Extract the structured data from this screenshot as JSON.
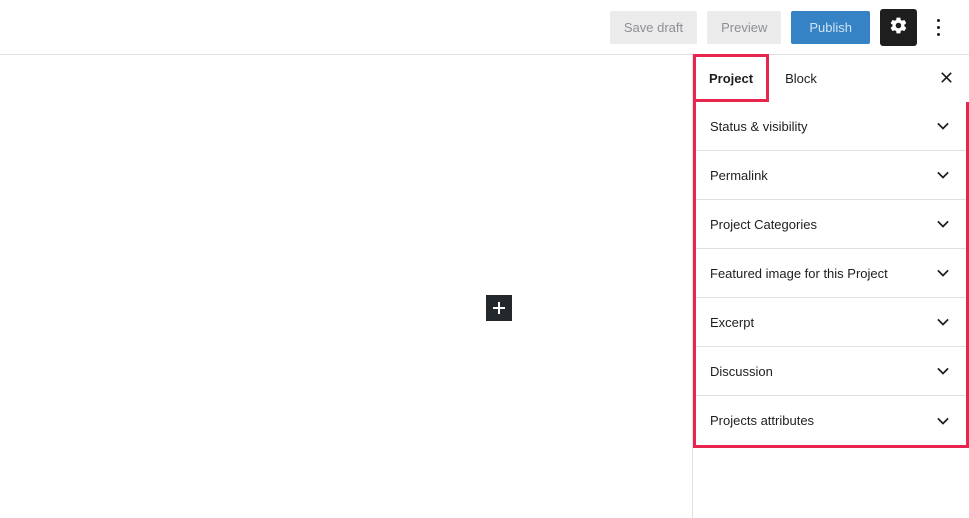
{
  "topbar": {
    "save_draft_label": "Save draft",
    "preview_label": "Preview",
    "publish_label": "Publish",
    "settings_icon": "gear-icon",
    "more_options_icon": "kebab-menu-icon",
    "colors": {
      "publish_bg": "#3582c4",
      "secondary_bg": "#ebebeb",
      "icon_button_bg": "#1e1e1e"
    }
  },
  "canvas": {
    "add_block_icon": "plus-icon"
  },
  "sidebar": {
    "tabs": [
      {
        "label": "Project",
        "active": true
      },
      {
        "label": "Block",
        "active": false
      }
    ],
    "close_icon": "close-icon",
    "panels": [
      {
        "label": "Status & visibility",
        "icon": "chevron-down-icon"
      },
      {
        "label": "Permalink",
        "icon": "chevron-down-icon"
      },
      {
        "label": "Project Categories",
        "icon": "chevron-down-icon"
      },
      {
        "label": "Featured image for this Project",
        "icon": "chevron-down-icon"
      },
      {
        "label": "Excerpt",
        "icon": "chevron-down-icon"
      },
      {
        "label": "Discussion",
        "icon": "chevron-down-icon"
      },
      {
        "label": "Projects attributes",
        "icon": "chevron-down-icon"
      }
    ],
    "highlight_color": "#e8254f",
    "active_tab_underline_color": "#2a7fbd"
  }
}
